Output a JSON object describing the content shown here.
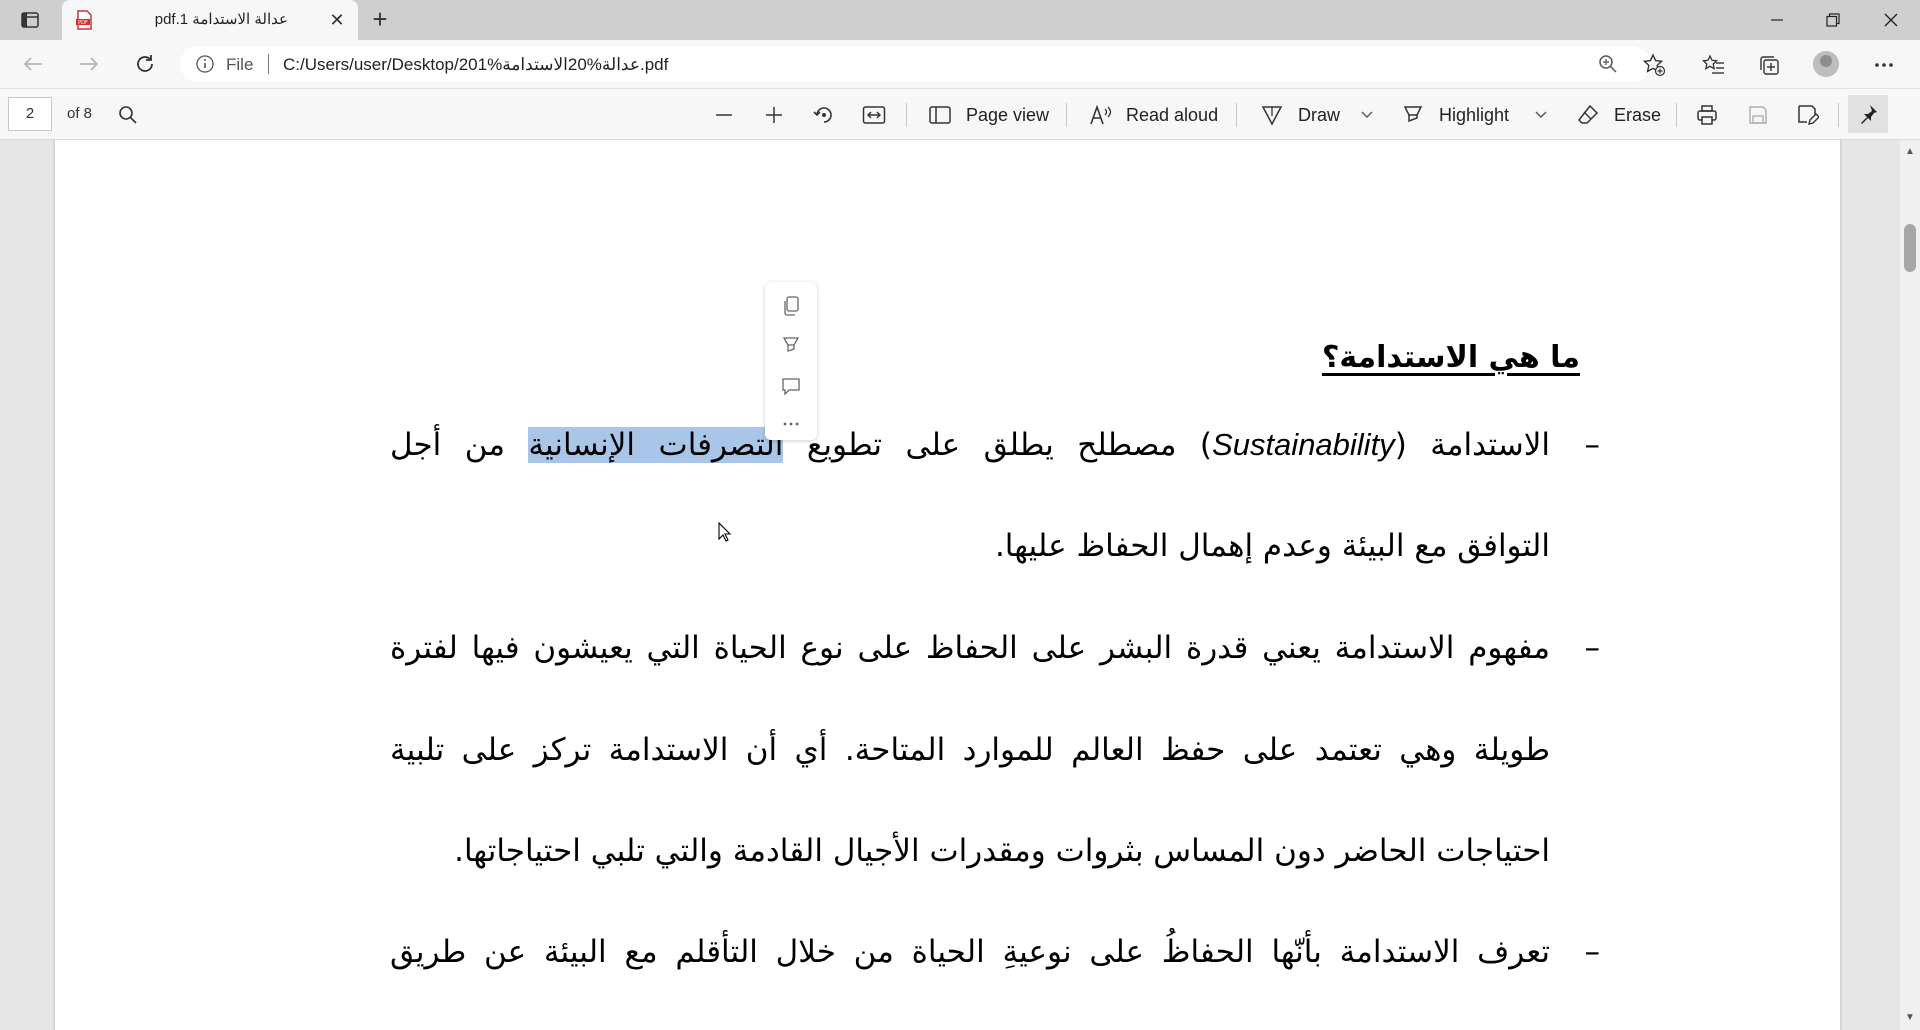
{
  "tab": {
    "title": "pdf.1 عدالة الاستدامة",
    "close_glyph": "✕",
    "new_tab_glyph": "+"
  },
  "address": {
    "scheme_label": "File",
    "url": "C:/Users/user/Desktop/201%عدالة%20الاستدامة.pdf"
  },
  "pdf_toolbar": {
    "page_number": "2",
    "page_count": "of 8",
    "page_view_label": "Page view",
    "read_aloud_label": "Read aloud",
    "draw_label": "Draw",
    "highlight_label": "Highlight",
    "erase_label": "Erase"
  },
  "document": {
    "heading": "ما هي الاستدامة؟",
    "dash": "–",
    "p1_line1_pre": "الاستدامة (",
    "p1_line1_latin": "Sustainability",
    "p1_line1_mid": ") مصطلح يطلق على تطويع ",
    "p1_line1_highlight": "التصرفات الإنسانية",
    "p1_line1_post": " من أجل",
    "p1_line2": "التوافق مع البيئة وعدم إهمال الحفاظ عليها.",
    "p2_line1": "مفهوم الاستدامة يعني قدرة البشر على الحفاظ على نوع الحياة التي يعيشون فيها لفترة",
    "p2_line2": "طويلة وهي تعتمد على حفظ العالم للموارد المتاحة. أي أن الاستدامة تركز على تلبية",
    "p2_line3": "احتياجات الحاضر دون المساس بثروات ومقدرات الأجيال القادمة والتي تلبي احتياجاتها.",
    "p3_line1": "تعرف الاستدامة بأنّها الحفاظُ على نوعيةِ الحياة من خلال التأقلم مع البيئة عن طريق"
  },
  "colors": {
    "highlight": "#a9c6e8",
    "chrome": "#f7f7f7",
    "tabstrip": "#cfcfcf"
  }
}
